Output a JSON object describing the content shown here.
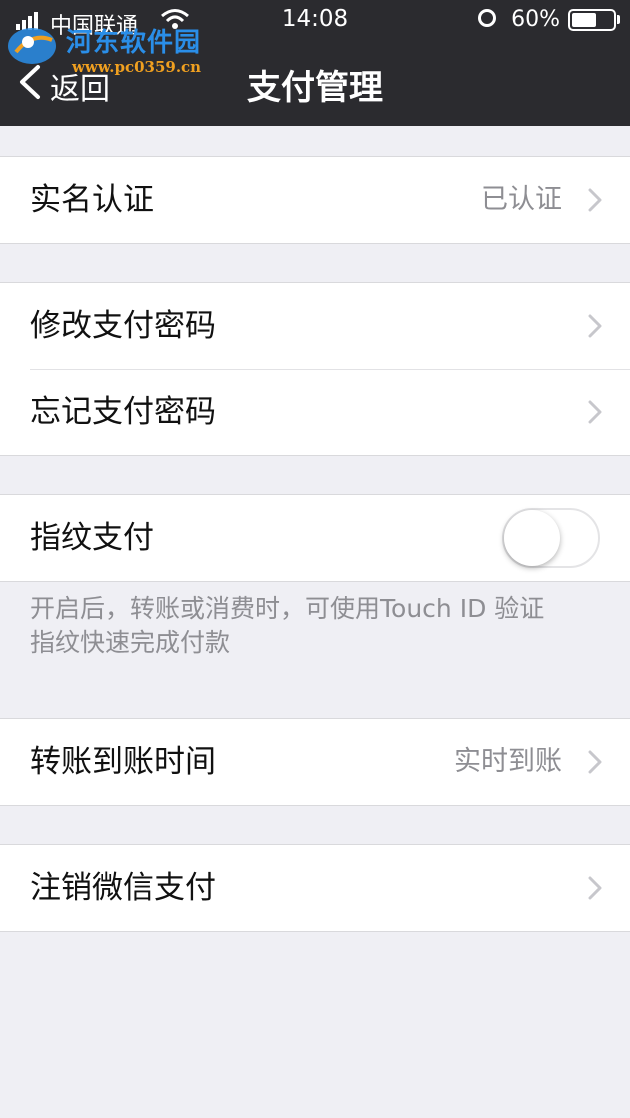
{
  "status_bar": {
    "carrier": "中国联通",
    "time": "14:08",
    "battery_percent": "60%",
    "battery_level": 0.6
  },
  "watermark": {
    "name": "河东软件园",
    "url": "www.pc0359.cn"
  },
  "nav": {
    "back_label": "返回",
    "title": "支付管理"
  },
  "sections": {
    "verification": {
      "label": "实名认证",
      "value": "已认证"
    },
    "change_password": {
      "label": "修改支付密码"
    },
    "forgot_password": {
      "label": "忘记支付密码"
    },
    "fingerprint": {
      "label": "指纹支付",
      "enabled": false
    },
    "fingerprint_note": {
      "line1": "开启后，转账或消费时，可使用Touch ID 验证",
      "line2": "指纹快速完成付款"
    },
    "transfer_time": {
      "label": "转账到账时间",
      "value": "实时到账"
    },
    "close_wechat_pay": {
      "label": "注销微信支付"
    }
  },
  "colors": {
    "nav_bg": "#2b2b2f",
    "page_bg": "#efeff4",
    "secondary_text": "#8e8e93"
  }
}
